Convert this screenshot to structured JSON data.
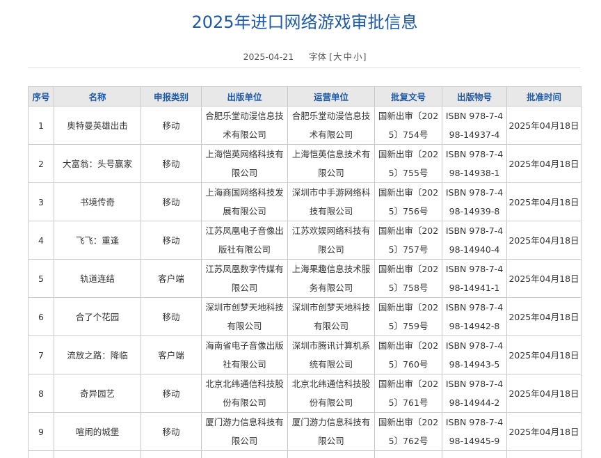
{
  "page": {
    "title": "2025年进口网络游戏审批信息",
    "date": "2025-04-21",
    "font_label": "字体",
    "font_bracket_open": "[",
    "font_bracket_close": "]",
    "font_sizes": [
      "大",
      "中",
      "小"
    ]
  },
  "colors": {
    "title": "#1f5aa6",
    "header_text": "#1f5aa6",
    "header_bg": "#e8e8e8",
    "border": "#c9c9c9"
  },
  "table": {
    "headers": [
      "序号",
      "名称",
      "申报类别",
      "出版单位",
      "运营单位",
      "批复文号",
      "出版物号",
      "批准时间"
    ],
    "rows": [
      [
        "1",
        "奥特曼英雄出击",
        "移动",
        "合肥乐堂动漫信息技术有限公司",
        "合肥乐堂动漫信息技术有限公司",
        "国新出审〔2025〕754号",
        "ISBN 978-7-498-14937-4",
        "2025年04月18日"
      ],
      [
        "2",
        "大富翁：头号赢家",
        "移动",
        "上海恺英网络科技有限公司",
        "上海恺英信息技术有限公司",
        "国新出审〔2025〕755号",
        "ISBN 978-7-498-14938-1",
        "2025年04月18日"
      ],
      [
        "3",
        "书境传奇",
        "移动",
        "上海商国网络科技发展有限公司",
        "深圳市中手游网络科技有限公司",
        "国新出审〔2025〕756号",
        "ISBN 978-7-498-14939-8",
        "2025年04月18日"
      ],
      [
        "4",
        "飞飞：重逢",
        "移动",
        "江苏凤凰电子音像出版社有限公司",
        "江苏欢娱网络科技有限公司",
        "国新出审〔2025〕757号",
        "ISBN 978-7-498-14940-4",
        "2025年04月18日"
      ],
      [
        "5",
        "轨道连结",
        "客户端",
        "江苏凤凰数字传媒有限公司",
        "上海果趣信息技术服务有限公司",
        "国新出审〔2025〕758号",
        "ISBN 978-7-498-14941-1",
        "2025年04月18日"
      ],
      [
        "6",
        "合了个花园",
        "移动",
        "深圳市创梦天地科技有限公司",
        "深圳市创梦天地科技有限公司",
        "国新出审〔2025〕759号",
        "ISBN 978-7-498-14942-8",
        "2025年04月18日"
      ],
      [
        "7",
        "流放之路：降临",
        "客户端",
        "海南省电子音像出版社有限公司",
        "深圳市腾讯计算机系统有限公司",
        "国新出审〔2025〕760号",
        "ISBN 978-7-498-14943-5",
        "2025年04月18日"
      ],
      [
        "8",
        "奇异园艺",
        "移动",
        "北京北纬通信科技股份有限公司",
        "北京北纬通信科技股份有限公司",
        "国新出审〔2025〕761号",
        "ISBN 978-7-498-14944-2",
        "2025年04月18日"
      ],
      [
        "9",
        "喧闹的城堡",
        "移动",
        "厦门游力信息科技有限公司",
        "厦门游力信息科技有限公司",
        "国新出审〔2025〕762号",
        "ISBN 978-7-498-14945-9",
        "2025年04月18日"
      ]
    ]
  }
}
